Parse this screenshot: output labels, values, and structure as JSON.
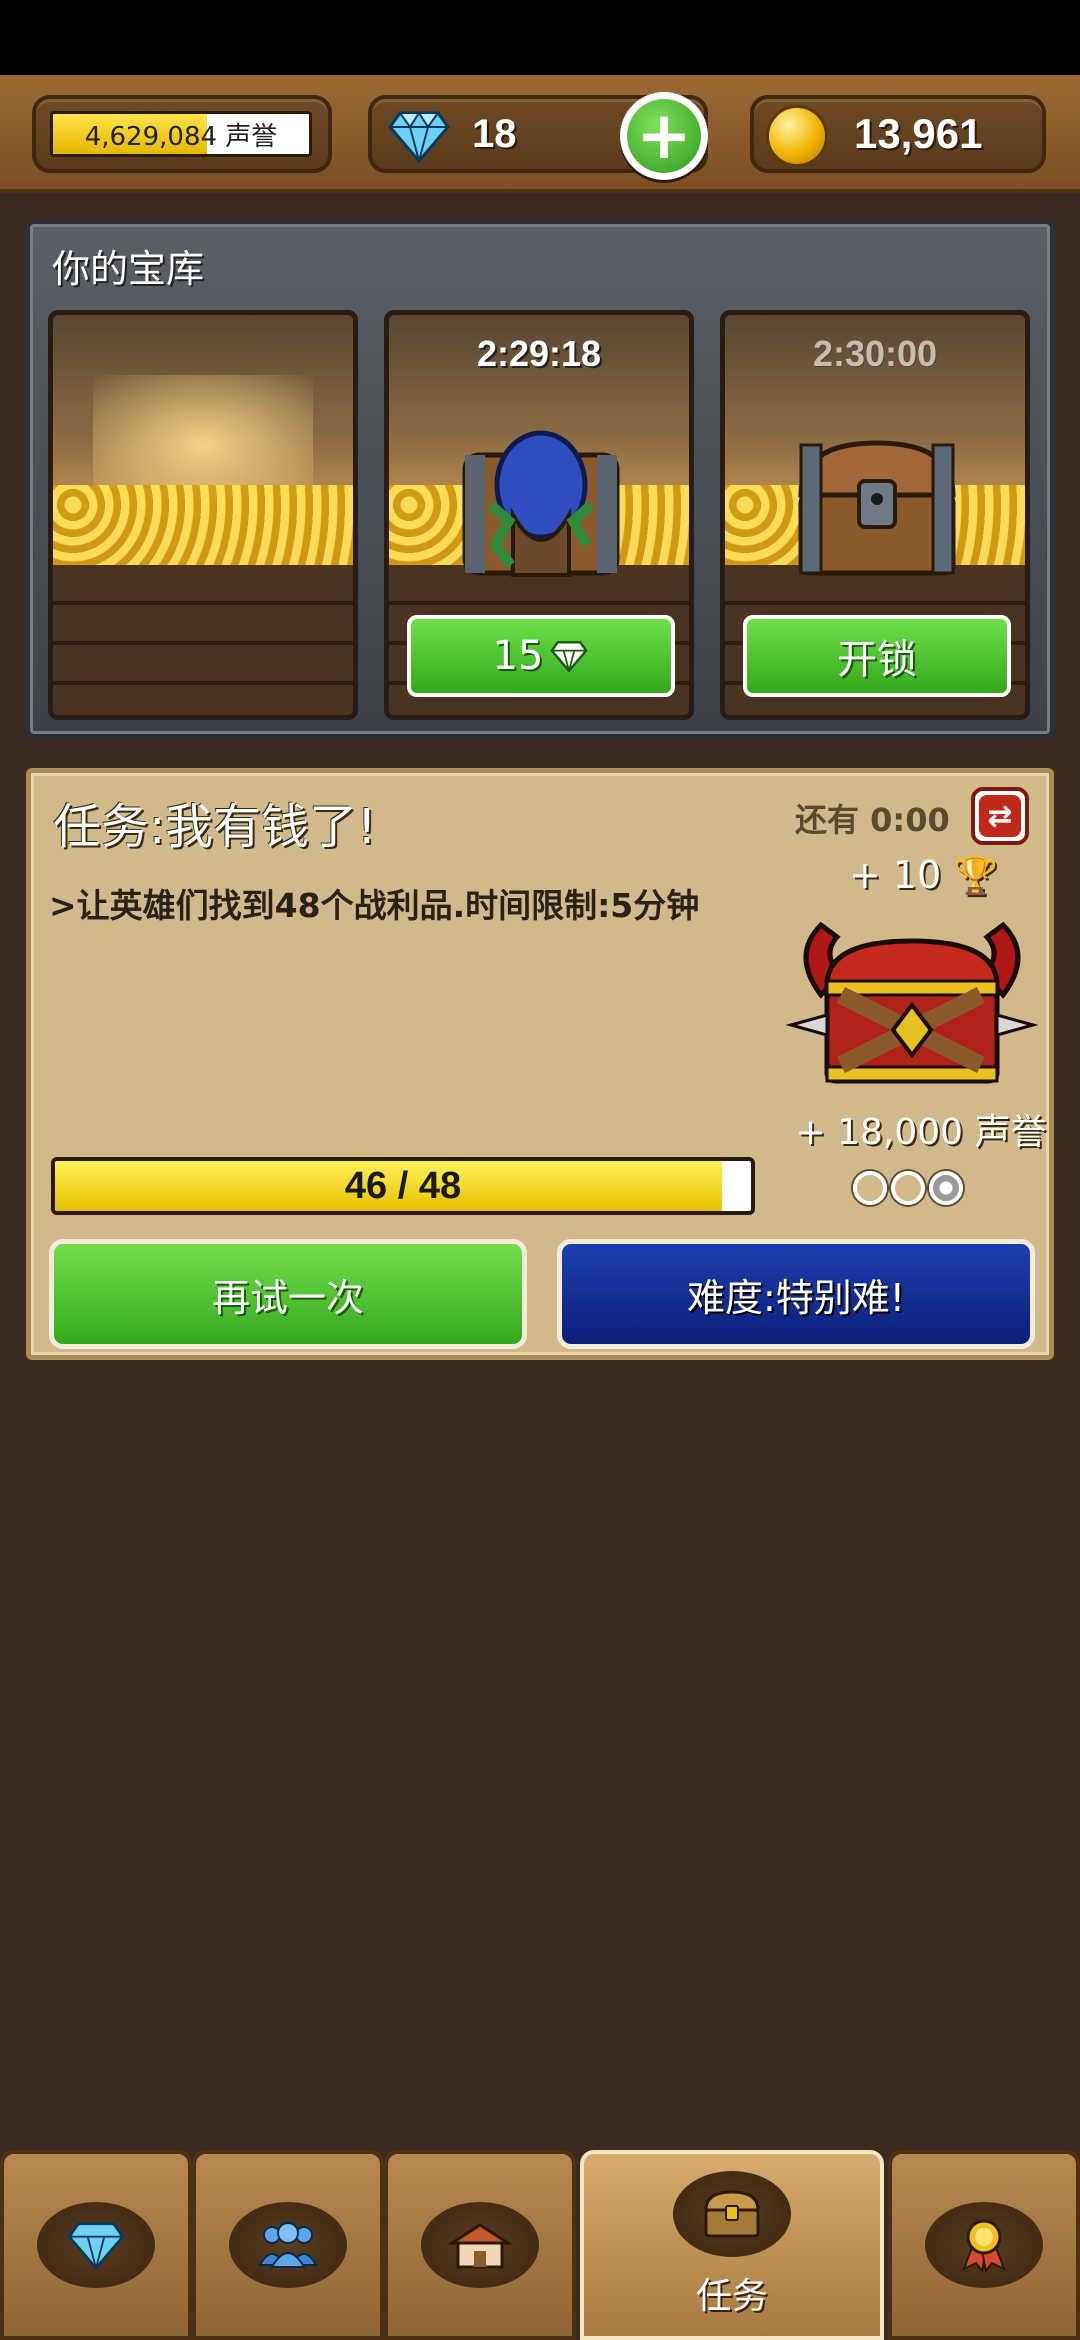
{
  "resources": {
    "fame_value": "4,629,084 声誉",
    "fame_progress": 0.6,
    "gems": "18",
    "gold": "13,961"
  },
  "vault": {
    "title": "你的宝库",
    "slots": [
      {
        "state": "empty"
      },
      {
        "timer": "2:29:18",
        "button_value": "15",
        "button_icon": "gem-icon"
      },
      {
        "timer": "2:30:00",
        "button_label": "开锁"
      }
    ]
  },
  "quest": {
    "title": "任务:我有钱了!",
    "time_left": "还有 0:00",
    "description": ">让英雄们找到48个战利品.时间限制:5分钟",
    "reward_trophies": "+ 10",
    "reward_fame": "+ 18,000 声誉",
    "progress_text": "46 / 48",
    "progress": 0.958,
    "retry_label": "再试一次",
    "difficulty_label": "难度:特别难!"
  },
  "nav": {
    "tabs": [
      {
        "icon": "gem-icon"
      },
      {
        "icon": "heroes-icon"
      },
      {
        "icon": "house-icon"
      },
      {
        "icon": "chest-icon",
        "label": "任务",
        "active": true
      },
      {
        "icon": "medal-icon"
      }
    ]
  },
  "colors": {
    "accent_green": "#36a91e",
    "accent_blue": "#0c1f78",
    "panel_tan": "#d2b98c",
    "wood_brown": "#8e6534"
  }
}
